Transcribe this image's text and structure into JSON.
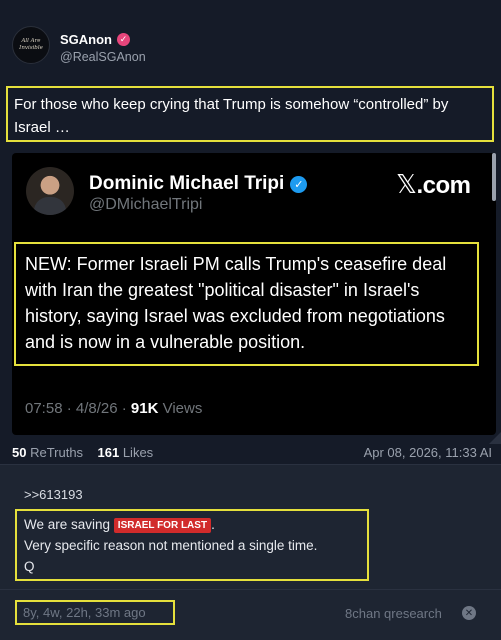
{
  "post": {
    "author_name": "SGAnon",
    "author_handle": "@RealSGAnon",
    "avatar_text_line1": "All Are",
    "avatar_text_line2": "Invisible",
    "body": "For those who keep crying that Trump is somehow “controlled” by Israel …"
  },
  "embed": {
    "name": "Dominic Michael Tripi",
    "handle": "@DMichaelTripi",
    "source_label": ".com",
    "text": "NEW: Former Israeli PM calls Trump's ceasefire deal with Iran the greatest \"political disaster\" in Israel's history, saying Israel was excluded from negotiations and is now in a vulnerable position.",
    "time": "07:58 · 4/8/26 · ",
    "views_count": "91K",
    "views_label": " Views"
  },
  "stats": {
    "retruths_count": "50",
    "retruths_label": " ReTruths",
    "likes_count": "161",
    "likes_label": " Likes",
    "date": "Apr 08, 2026, 11:33 AI"
  },
  "drop": {
    "ref": ">>613193",
    "line1_prefix": "We are saving ",
    "tag": "ISRAEL FOR LAST",
    "line1_suffix": ".",
    "line2": "Very specific reason not mentioned a single time.",
    "line3": "Q",
    "age": "8y, 4w, 22h, 33m ago",
    "source": "8chan qresearch"
  },
  "icons": {
    "verified_pink": "verified-badge-icon",
    "verified_blue": "verified-check-icon",
    "x_logo": "x-logo-icon",
    "close": "close-circle-icon"
  },
  "colors": {
    "highlight_border": "#e5e03c",
    "tag_red": "#d12b2b",
    "pink_badge": "#e7457b",
    "blue_badge": "#1d9bf0"
  }
}
